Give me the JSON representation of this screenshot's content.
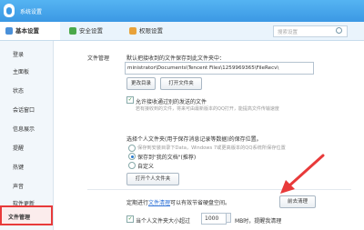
{
  "window": {
    "title": "系统设置"
  },
  "tabs": [
    {
      "label": "基本设置",
      "color": "#4a90d9"
    },
    {
      "label": "安全设置",
      "color": "#4aa84a"
    },
    {
      "label": "权限设置",
      "color": "#e8a23a"
    }
  ],
  "search": {
    "placeholder": "搜索设置"
  },
  "sidebar": {
    "items": [
      "登录",
      "主面板",
      "状态",
      "会话窗口",
      "信息展示",
      "提醒",
      "热键",
      "声音",
      "软件更新",
      "文件管理"
    ],
    "selected": "文件管理"
  },
  "file_management": {
    "section_label": "文件管理",
    "save_to_text": "默认把接收到的文件保存到此文件夹中：",
    "path_value": "ministrator\\Documents\\Tencent Files\\1259969365\\FileRecv\\",
    "change_dir_button": "更改目录",
    "open_folder_button": "打开文件夹",
    "allow_folder_text": "允许接收通过别的发送的文件",
    "allow_folder_desc": "若有接收到的文件，将来可由最新版本的QQ打开，能提高文件传输速度",
    "personal_folder_text": "选择个人文件夹(用于保存消息记录等数据)的保存位置。",
    "option_system": "保存到安装目录下Data，Windows 7或更高版本的QQ系统所保存位置",
    "option_my_docs": "保存到\"我的文档\"(推荐)",
    "option_custom": "自定义",
    "open_personal_folder_button": "打开个人文件夹",
    "cleanup_text_prefix": "定期进行",
    "cleanup_link": "文件清理",
    "cleanup_text_suffix": "可以有效节省硬盘空间。",
    "cleanup_button": "前去清理",
    "threshold_prefix": "当个人文件夹大小超过",
    "threshold_value": "1000",
    "threshold_unit": "MB时，提醒我清理"
  }
}
